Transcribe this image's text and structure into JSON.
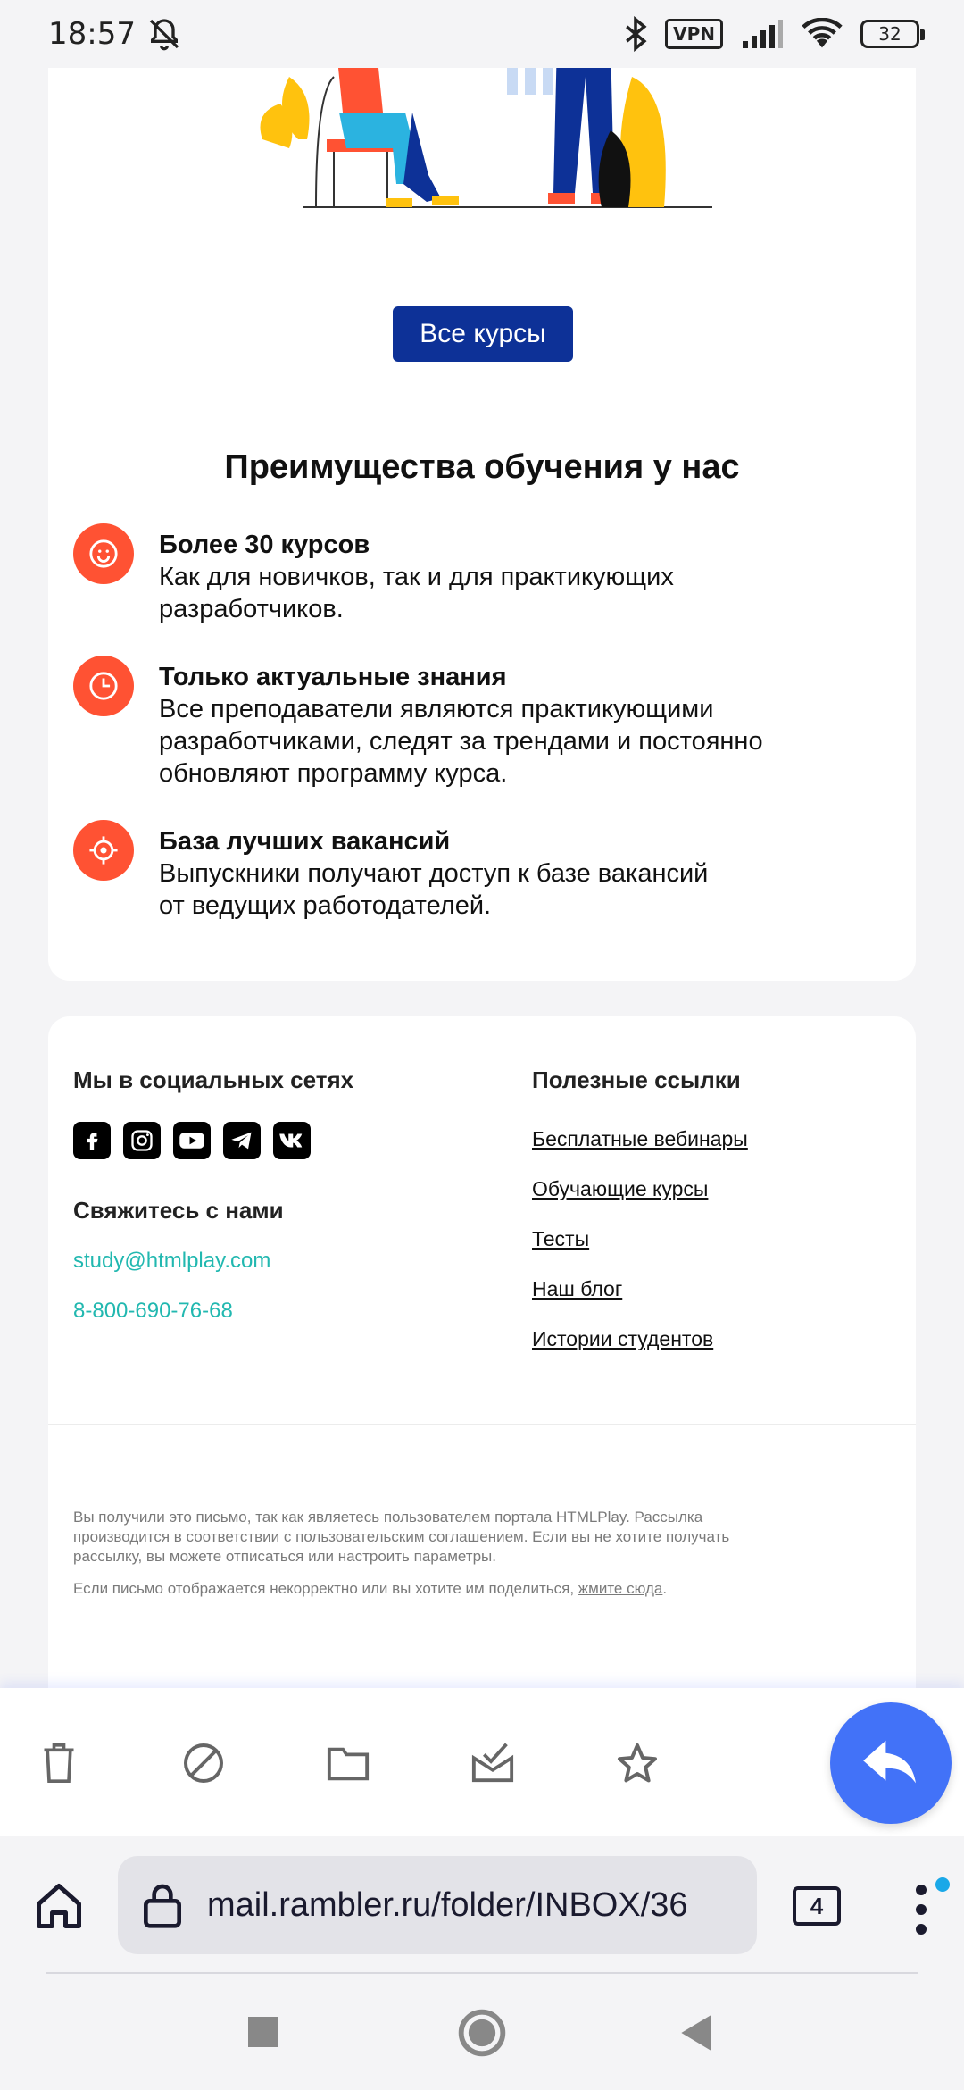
{
  "status_bar": {
    "time": "18:57",
    "vpn": "VPN",
    "battery": "32"
  },
  "email": {
    "courses_button": "Все курсы",
    "advantages_title": "Преимущества обучения у нас",
    "features": [
      {
        "title": "Более 30 курсов",
        "line1": "Как для новичков, так и для практикующих",
        "line2": "разработчиков.",
        "line3": "",
        "icon": "smile-icon"
      },
      {
        "title": "Только актуальные знания",
        "line1": "Все преподаватели являются практикующими",
        "line2": "разработчиками, следят за трендами и постоянно",
        "line3": "обновляют программу курса.",
        "icon": "clock-icon"
      },
      {
        "title": "База лучших вакансий",
        "line1": "Выпускники получают доступ к базе вакансий",
        "line2": "от ведущих работодателей.",
        "line3": "",
        "icon": "target-icon"
      }
    ],
    "footer": {
      "social_title": "Мы в социальных сетях",
      "contact_title": "Свяжитесь с нами",
      "email": "study@htmlplay.com",
      "phone": "8-800-690-76-68",
      "links_title": "Полезные ссылки",
      "links": [
        "Бесплатные вебинары",
        "Обучающие курсы",
        "Тесты",
        "Наш блог",
        "Истории студентов"
      ],
      "disclaimer_line1": "Вы получили это письмо, так как являетесь пользователем портала HTMLPlay. Рассылка",
      "disclaimer_line2": "производится в соответствии с пользовательским соглашением. Если вы не хотите получать",
      "disclaimer_line3": "рассылку, вы можете отписаться или настроить параметры.",
      "disclaimer2_text": "Если письмо отображается некорректно или вы хотите им поделиться, ",
      "disclaimer2_link": "жмите сюда",
      "disclaimer2_end": "."
    }
  },
  "browser": {
    "url": "mail.rambler.ru/folder/INBOX/36",
    "tabs_count": "4"
  },
  "colors": {
    "button_blue": "#0d3197",
    "feature_orange": "#ff5233",
    "link_teal": "#22b8b0",
    "fab_blue": "#4272f8"
  }
}
